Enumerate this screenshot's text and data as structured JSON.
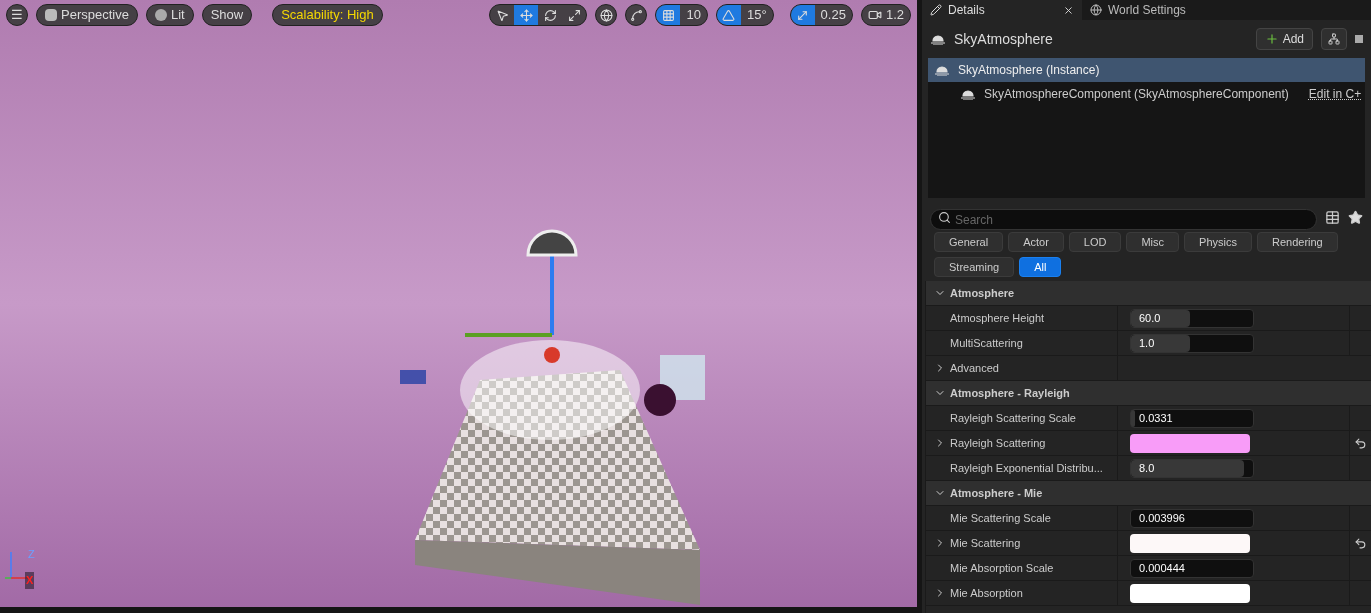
{
  "viewport": {
    "menu_button": "☰",
    "view_mode": "Perspective",
    "lighting": "Lit",
    "show": "Show",
    "scalability": "Scalability: High",
    "transform_tools": [
      {
        "kind": "select",
        "selected": false
      },
      {
        "kind": "move",
        "selected": true
      },
      {
        "kind": "rotate",
        "selected": false
      },
      {
        "kind": "scale",
        "selected": false
      }
    ],
    "snaps": [
      {
        "kind": "grid",
        "on": true,
        "value": "10"
      },
      {
        "kind": "angle",
        "on": true,
        "value": "15°"
      },
      {
        "kind": "scale",
        "on": true,
        "value": "0.25"
      }
    ],
    "camera_speed": "1.2",
    "axis_labels": [
      "Z",
      "X"
    ]
  },
  "panel": {
    "tabs": [
      {
        "label": "Details",
        "selected": true
      },
      {
        "label": "World Settings",
        "selected": false
      }
    ],
    "actor": "SkyAtmosphere",
    "add_button": "Add",
    "tree": [
      {
        "label": "SkyAtmosphere (Instance)",
        "selected": true
      },
      {
        "label": "SkyAtmosphereComponent (SkyAtmosphereComponent)",
        "selected": false,
        "link": "Edit in C+"
      }
    ],
    "search": {
      "placeholder": "Search"
    },
    "filters": [
      {
        "label": "General",
        "selected": false
      },
      {
        "label": "Actor",
        "selected": false
      },
      {
        "label": "LOD",
        "selected": false
      },
      {
        "label": "Misc",
        "selected": false
      },
      {
        "label": "Physics",
        "selected": false
      },
      {
        "label": "Rendering",
        "selected": false
      },
      {
        "label": "Streaming",
        "selected": false
      },
      {
        "label": "All",
        "selected": true
      }
    ],
    "rows": [
      {
        "kind": "header",
        "label": "Atmosphere"
      },
      {
        "kind": "number",
        "label": "Atmosphere Height",
        "value": "60.0",
        "level": 0.48
      },
      {
        "kind": "number",
        "label": "MultiScattering",
        "value": "1.0",
        "level": 0.48
      },
      {
        "kind": "group",
        "label": "Advanced"
      },
      {
        "kind": "header",
        "label": "Atmosphere - Rayleigh"
      },
      {
        "kind": "number",
        "label": "Rayleigh Scattering Scale",
        "value": "0.0331",
        "level": 0.03
      },
      {
        "kind": "color",
        "label": "Rayleigh Scattering",
        "color": "#f89cf8",
        "resettable": true
      },
      {
        "kind": "number",
        "label": "Rayleigh Exponential Distribu...",
        "value": "8.0",
        "level": 0.93
      },
      {
        "kind": "header",
        "label": "Atmosphere - Mie"
      },
      {
        "kind": "number",
        "label": "Mie Scattering Scale",
        "value": "0.003996",
        "level": 0
      },
      {
        "kind": "color",
        "label": "Mie Scattering",
        "color": "#fdf8f8",
        "resettable": true
      },
      {
        "kind": "number",
        "label": "Mie Absorption Scale",
        "value": "0.000444",
        "level": 0
      },
      {
        "kind": "color",
        "label": "Mie Absorption",
        "color": "#ffffff",
        "resettable": false
      }
    ]
  }
}
